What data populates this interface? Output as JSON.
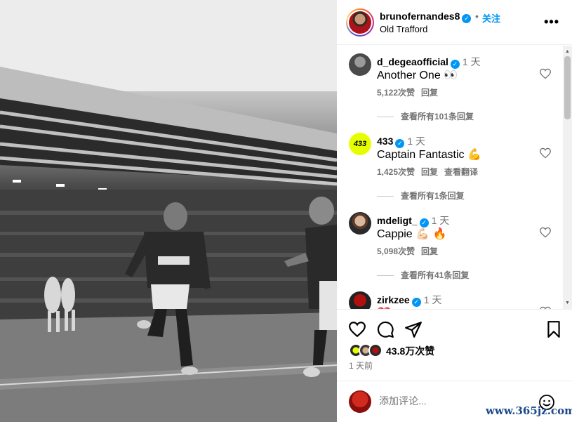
{
  "post": {
    "username": "brunofernandes8",
    "follow_label": "关注",
    "separator": "•",
    "location": "Old Trafford",
    "more_label": "•••"
  },
  "comments": [
    {
      "username": "d_degeaofficial",
      "time": "1 天",
      "text": "Another One 👀",
      "likes": "5,122次赞",
      "reply": "回复",
      "translate": "",
      "replies": "查看所有101条回复"
    },
    {
      "username": "433",
      "time": "1 天",
      "text": "Captain Fantastic 💪",
      "likes": "1,425次赞",
      "reply": "回复",
      "translate": "查看翻译",
      "replies": "查看所有1条回复"
    },
    {
      "username": "mdeligt_",
      "time": "1 天",
      "text": "Cappie 💪🏻 🔥",
      "likes": "5,098次赞",
      "reply": "回复",
      "translate": "",
      "replies": "查看所有41条回复"
    },
    {
      "username": "zirkzee",
      "time": "1 天",
      "text": "❤️"
    }
  ],
  "likes": {
    "count": "43.8万次赞",
    "time_ago": "1 天前"
  },
  "add_comment": {
    "placeholder": "添加评论..."
  },
  "watermark": "www.365jz.com",
  "colors": {
    "accent": "#0095f6",
    "muted": "#737373"
  }
}
